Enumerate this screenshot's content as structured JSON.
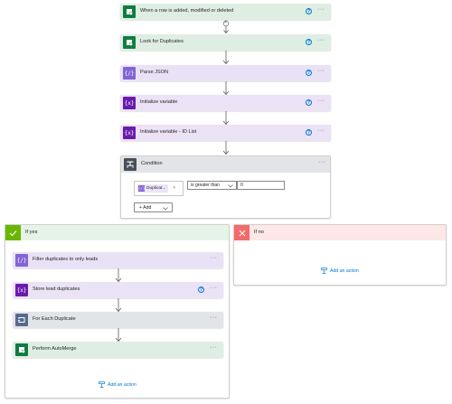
{
  "flow": {
    "steps": [
      {
        "title": "When a row is added, modified or deleted",
        "help": "?",
        "more": "···"
      },
      {
        "title": "Look for Duplicates",
        "help": "?",
        "more": "···"
      },
      {
        "title": "Parse JSON",
        "help": "?",
        "more": "···"
      },
      {
        "title": "Initialize variable",
        "help": "?",
        "more": "···"
      },
      {
        "title": "Initialize variable - ID List",
        "help": "?",
        "more": "···"
      }
    ],
    "connector_plus": "+",
    "condition": {
      "title": "Condition",
      "more": "···",
      "left_operand": "Duplicat...",
      "token_remove": "×",
      "operator": "is greater than",
      "right_operand": "0",
      "add_label": "+ Add"
    },
    "if_yes": {
      "title": "If yes",
      "steps": [
        {
          "title": "Filter duplicates to only leads",
          "more": "···"
        },
        {
          "title": "Store lead duplicates",
          "help": "?",
          "more": "···"
        },
        {
          "title": "For Each Duplicate",
          "more": "···"
        },
        {
          "title": "Perform AutoMerge",
          "more": "···"
        }
      ],
      "add_action": "Add an action"
    },
    "if_no": {
      "title": "If no",
      "add_action": "Add an action"
    }
  },
  "colors": {
    "dataverse": "#107c41",
    "data_operation": "#8264d4",
    "variable": "#6b1bab",
    "control": "#484f58",
    "loop": "#566b8b",
    "link": "#0078d4",
    "yes_header": "#e5f4e7",
    "no_header": "#fde7e7"
  }
}
